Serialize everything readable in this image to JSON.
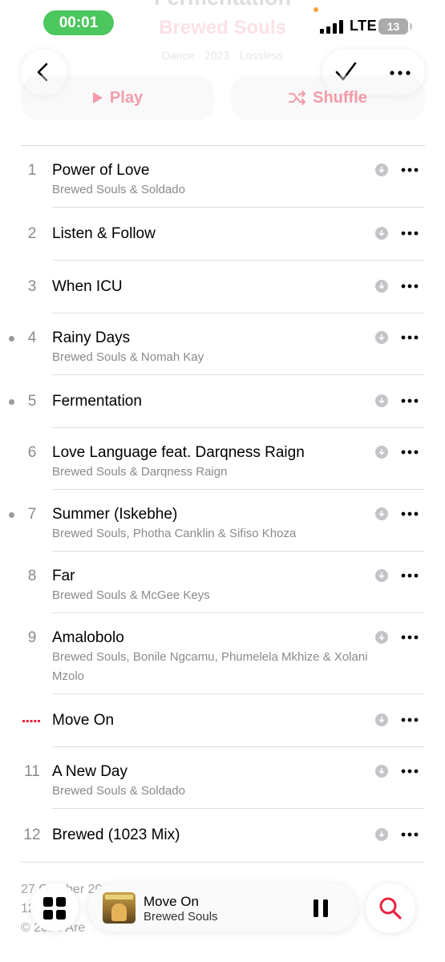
{
  "album": {
    "title": "Fermentation",
    "artist": "Brewed Souls",
    "meta": "Dance · 2023 · Lossless"
  },
  "status_bar": {
    "time": "00:01",
    "network": "LTE",
    "battery": "13",
    "battery_color": "#e8233f",
    "time_pill_color": "#4cc75e"
  },
  "nav": {
    "back_icon": "chevron-left-icon",
    "check_icon": "checkmark-icon",
    "more_icon": "ellipsis-icon"
  },
  "actions": {
    "play_label": "Play",
    "shuffle_label": "Shuffle"
  },
  "tracks": [
    {
      "number": "1",
      "title": "Power of Love",
      "artist": "Brewed Souls & Soldado"
    },
    {
      "number": "2",
      "title": "Listen & Follow",
      "artist": ""
    },
    {
      "number": "3",
      "title": "When ICU",
      "artist": ""
    },
    {
      "number": "4",
      "title": "Rainy Days",
      "artist": "Brewed Souls & Nomah Kay"
    },
    {
      "number": "5",
      "title": "Fermentation",
      "artist": ""
    },
    {
      "number": "6",
      "title": "Love Language feat. Darqness Raign",
      "artist": "Brewed Souls & Darqness Raign"
    },
    {
      "number": "7",
      "title": "Summer (Iskebhe)",
      "artist": "Brewed Souls, Photha Canklin & Sifiso Khoza"
    },
    {
      "number": "8",
      "title": "Far",
      "artist": "Brewed Souls & McGee Keys"
    },
    {
      "number": "9",
      "title": "Amalobolo",
      "artist": "Brewed Souls, Bonile Ngcamu, Phumelela Mkhize & Xolani Mzolo"
    },
    {
      "number": "",
      "title": "Move On",
      "artist": "",
      "now_playing": true
    },
    {
      "number": "11",
      "title": "A New Day",
      "artist": "Brewed Souls & Soldado"
    },
    {
      "number": "12",
      "title": "Brewed (1023 Mix)",
      "artist": ""
    }
  ],
  "footer": {
    "line1": "27 October 20",
    "line2": "12",
    "line3": "© 2023 Are"
  },
  "mini_player": {
    "title": "Move On",
    "artist": "Brewed Souls"
  },
  "colors": {
    "accent": "#e8233f",
    "secondary_text": "#8a8a8e"
  }
}
